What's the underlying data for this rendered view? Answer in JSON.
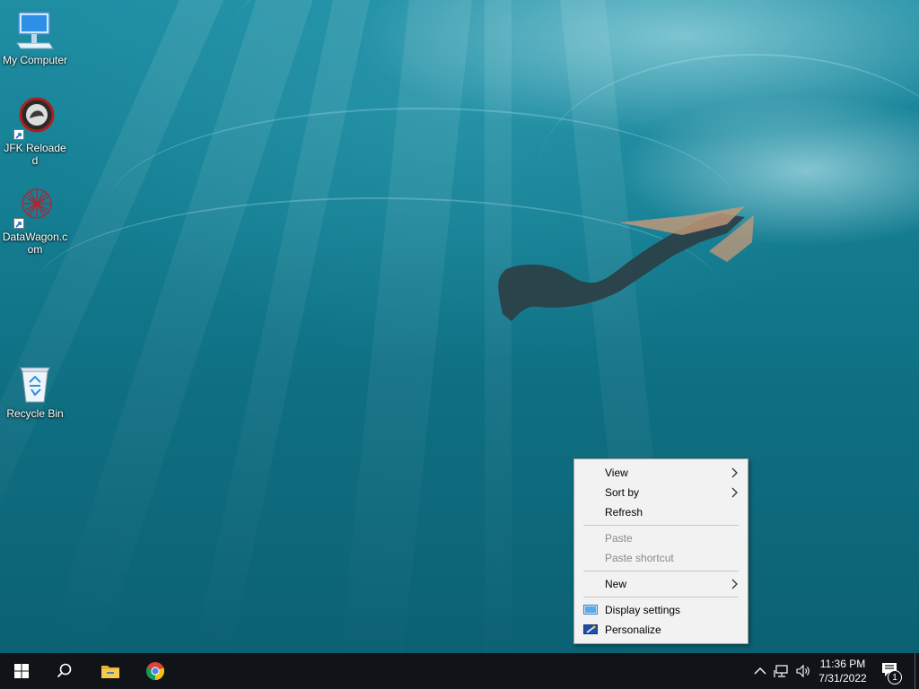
{
  "desktop": {
    "icons": [
      {
        "label": "My Computer",
        "icon": "computer-icon"
      },
      {
        "label": "JFK Reloaded",
        "icon": "jfk-reloaded-icon"
      },
      {
        "label": "DataWagon.com",
        "icon": "datawagon-icon"
      },
      {
        "label": "Recycle Bin",
        "icon": "recycle-bin-icon"
      }
    ]
  },
  "context_menu": {
    "view": "View",
    "sort_by": "Sort by",
    "refresh": "Refresh",
    "paste": "Paste",
    "paste_shortcut": "Paste shortcut",
    "new": "New",
    "display_settings": "Display settings",
    "personalize": "Personalize"
  },
  "taskbar": {
    "buttons": [
      "start-icon",
      "search-icon",
      "file-explorer-icon",
      "chrome-icon"
    ],
    "tray": {
      "time": "11:36 PM",
      "date": "7/31/2022",
      "notification_count": "1"
    }
  },
  "colors": {
    "taskbar": "#101418",
    "menu_bg": "#f2f2f2",
    "disabled_text": "#8a8a8a"
  }
}
